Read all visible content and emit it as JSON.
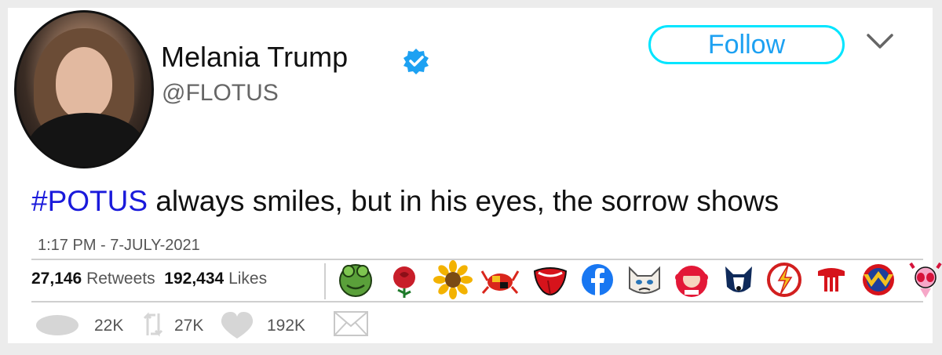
{
  "profile": {
    "name": "Melania Trump",
    "handle": "@FLOTUS",
    "verified": true
  },
  "follow_label": "Follow",
  "tweet": {
    "hashtag": "#POTUS",
    "text": " always smiles, but in his eyes, the sorrow shows",
    "timestamp": "1:17 PM - 7-JULY-2021"
  },
  "stats": {
    "retweets_count": "27,146",
    "retweets_label": "Retweets",
    "likes_count": "192,434",
    "likes_label": "Likes"
  },
  "liker_badges": [
    "frog-badge",
    "rose-badge",
    "sunflower-badge",
    "maryland-crab-badge",
    "tongue-logo-badge",
    "facebook-badge",
    "grumpy-cat-badge",
    "wendys-badge",
    "husky-badge",
    "flash-badge",
    "trident-badge",
    "wonder-woman-badge",
    "powerpuff-badge"
  ],
  "actions": {
    "reply_count": "22K",
    "retweet_count": "27K",
    "like_count": "192K"
  },
  "colors": {
    "hashtag": "#1a1adb",
    "follow_border": "#00e5ff",
    "follow_text": "#1da1f2",
    "verified": "#1da1f2"
  }
}
